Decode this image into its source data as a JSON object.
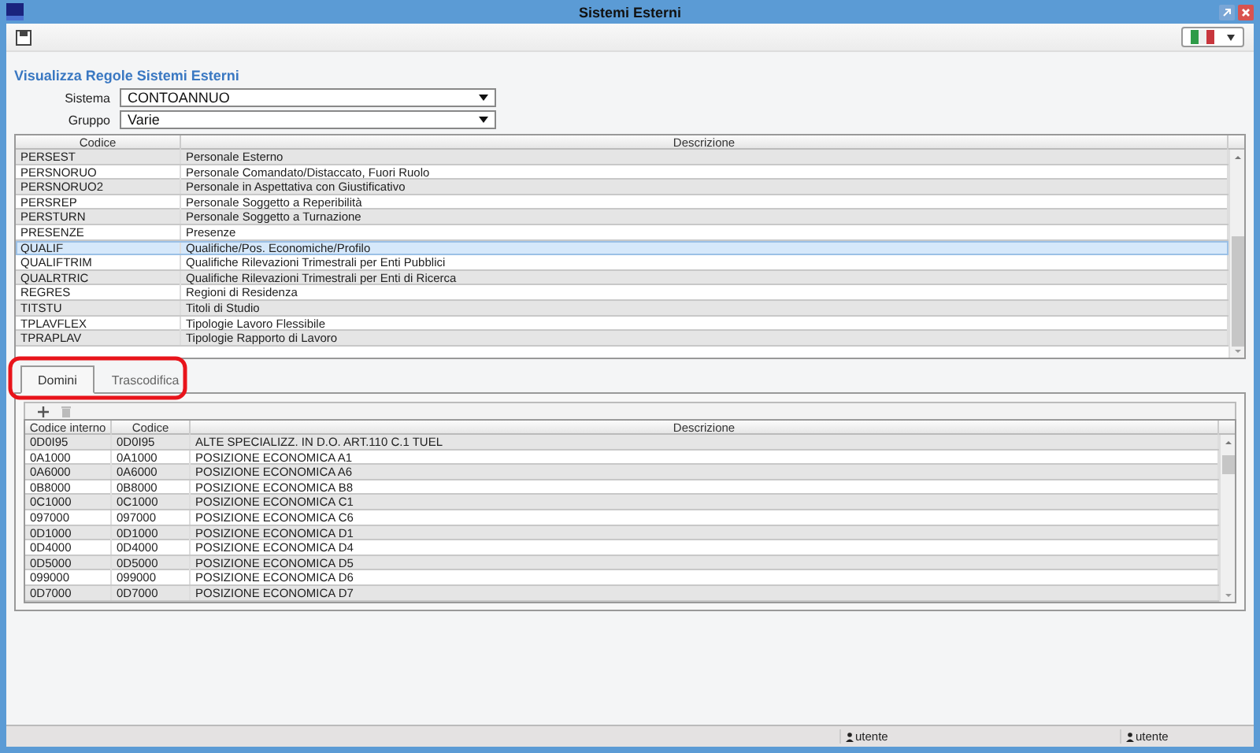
{
  "window": {
    "title": "Sistemi Esterni"
  },
  "heading": "Visualizza Regole Sistemi Esterni",
  "filters": [
    {
      "label": "Sistema",
      "value": "CONTOANNUO"
    },
    {
      "label": "Gruppo",
      "value": "Varie"
    }
  ],
  "rules_table": {
    "columns": [
      "Codice",
      "Descrizione"
    ],
    "rows": [
      {
        "cells": [
          "PERSEST",
          "Personale Esterno"
        ],
        "selected": false
      },
      {
        "cells": [
          "PERSNORUO",
          "Personale Comandato/Distaccato, Fuori Ruolo"
        ],
        "selected": false
      },
      {
        "cells": [
          "PERSNORUO2",
          "Personale in Aspettativa con Giustificativo"
        ],
        "selected": false
      },
      {
        "cells": [
          "PERSREP",
          "Personale Soggetto a Reperibilità"
        ],
        "selected": false
      },
      {
        "cells": [
          "PERSTURN",
          "Personale Soggetto a Turnazione"
        ],
        "selected": false
      },
      {
        "cells": [
          "PRESENZE",
          "Presenze"
        ],
        "selected": false
      },
      {
        "cells": [
          "QUALIF",
          "Qualifiche/Pos. Economiche/Profilo"
        ],
        "selected": true
      },
      {
        "cells": [
          "QUALIFTRIM",
          "Qualifiche Rilevazioni Trimestrali per Enti Pubblici"
        ],
        "selected": false
      },
      {
        "cells": [
          "QUALRTRIC",
          "Qualifiche Rilevazioni Trimestrali per Enti di Ricerca"
        ],
        "selected": false
      },
      {
        "cells": [
          "REGRES",
          "Regioni di Residenza"
        ],
        "selected": false
      },
      {
        "cells": [
          "TITSTU",
          "Titoli di Studio"
        ],
        "selected": false
      },
      {
        "cells": [
          "TPLAVFLEX",
          "Tipologie Lavoro Flessibile"
        ],
        "selected": false
      },
      {
        "cells": [
          "TPRAPLAV",
          "Tipologie Rapporto di Lavoro"
        ],
        "selected": false
      }
    ]
  },
  "tabs": [
    {
      "label": "Domini",
      "selected": true
    },
    {
      "label": "Trascodifica",
      "selected": false
    }
  ],
  "domains_table": {
    "columns": [
      "Codice interno",
      "Codice",
      "Descrizione"
    ],
    "rows": [
      [
        "0D0I95",
        "0D0I95",
        "ALTE SPECIALIZZ. IN D.O. ART.110 C.1 TUEL"
      ],
      [
        "0A1000",
        "0A1000",
        "POSIZIONE ECONOMICA A1"
      ],
      [
        "0A6000",
        "0A6000",
        "POSIZIONE ECONOMICA A6"
      ],
      [
        "0B8000",
        "0B8000",
        "POSIZIONE ECONOMICA B8"
      ],
      [
        "0C1000",
        "0C1000",
        "POSIZIONE ECONOMICA C1"
      ],
      [
        "097000",
        "097000",
        "POSIZIONE ECONOMICA C6"
      ],
      [
        "0D1000",
        "0D1000",
        "POSIZIONE ECONOMICA D1"
      ],
      [
        "0D4000",
        "0D4000",
        "POSIZIONE ECONOMICA D4"
      ],
      [
        "0D5000",
        "0D5000",
        "POSIZIONE ECONOMICA D5"
      ],
      [
        "099000",
        "099000",
        "POSIZIONE ECONOMICA D6"
      ],
      [
        "0D7000",
        "0D7000",
        "POSIZIONE ECONOMICA D7"
      ]
    ]
  },
  "status_bar": {
    "users": [
      "utente",
      "utente"
    ]
  }
}
